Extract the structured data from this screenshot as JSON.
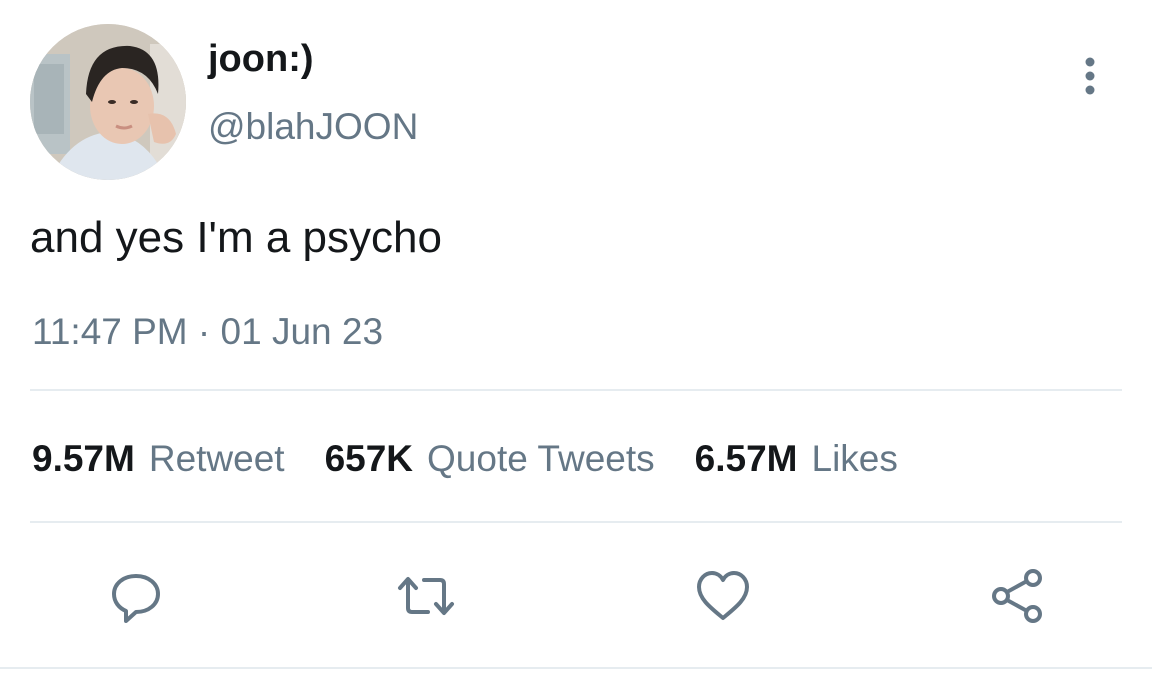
{
  "tweet": {
    "author": {
      "display_name": "joon:)",
      "handle": "@blahJOON",
      "avatar_icon": "profile-photo"
    },
    "text": "and yes I'm a psycho",
    "timestamp": "11:47 PM · 01 Jun 23",
    "stats": [
      {
        "count": "9.57M",
        "label": "Retweet"
      },
      {
        "count": "657K",
        "label": "Quote Tweets"
      },
      {
        "count": "6.57M",
        "label": "Likes"
      }
    ],
    "actions": [
      {
        "icon": "reply-icon"
      },
      {
        "icon": "retweet-icon"
      },
      {
        "icon": "heart-icon"
      },
      {
        "icon": "share-icon"
      }
    ],
    "menu_icon": "more-vertical-icon"
  },
  "colors": {
    "text_primary": "#14171a",
    "text_secondary": "#657786",
    "divider": "#e6ecf0",
    "icon": "#657786"
  }
}
